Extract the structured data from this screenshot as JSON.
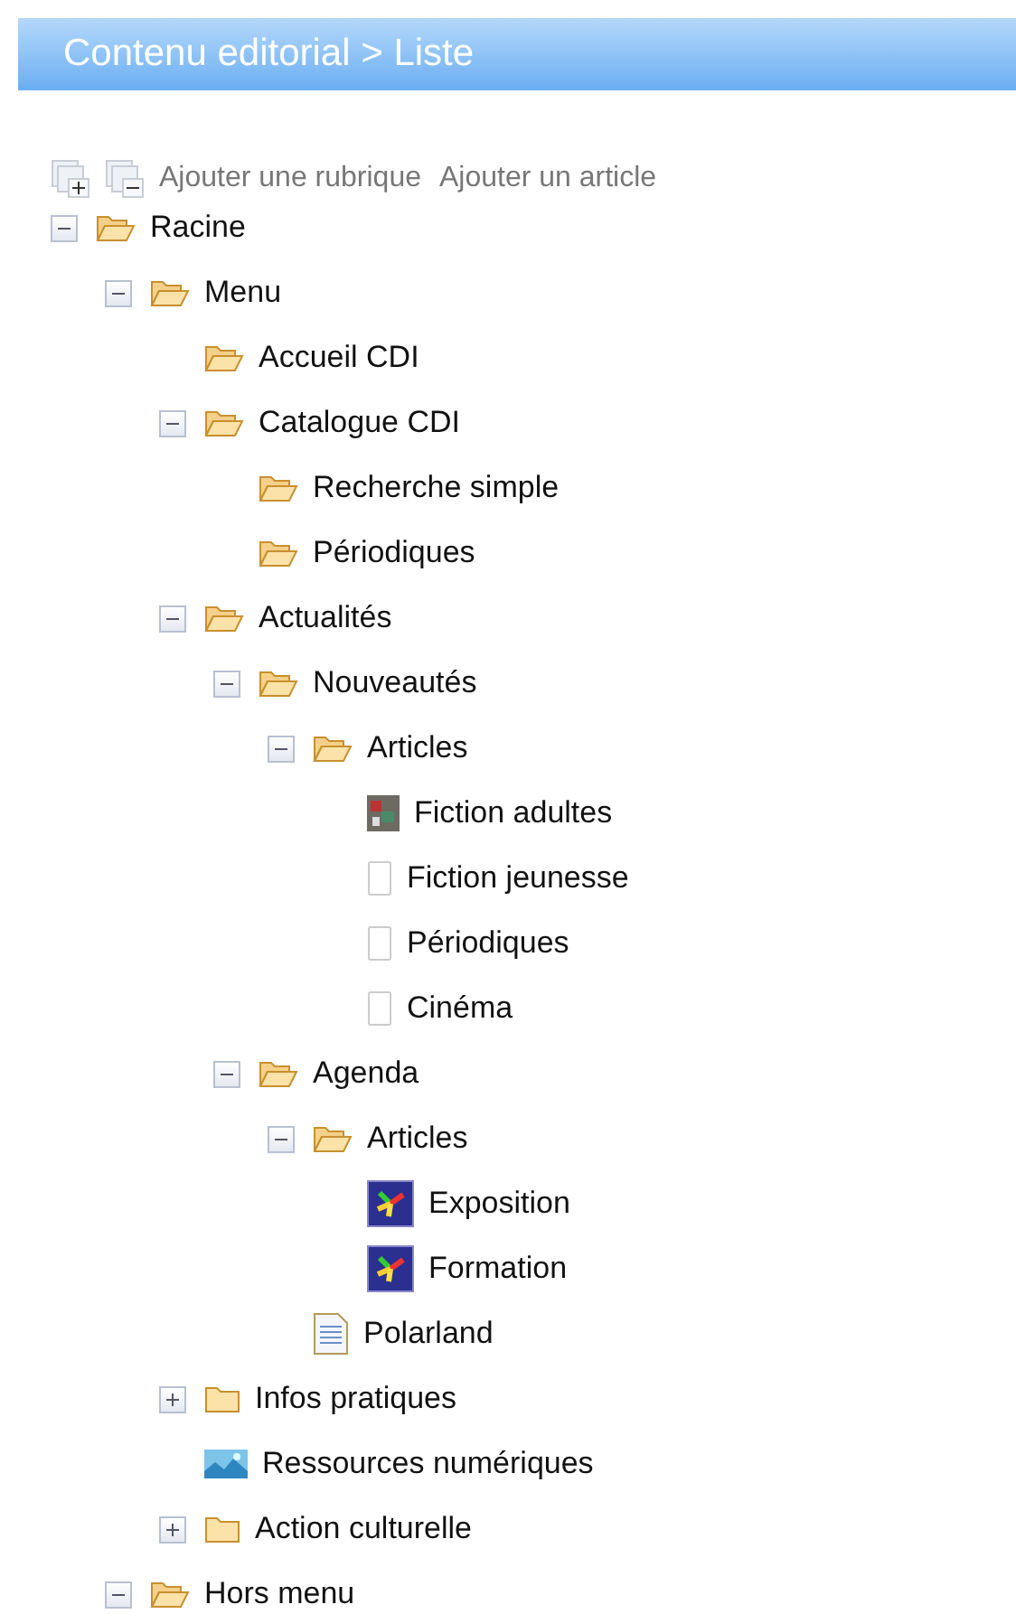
{
  "header": {
    "title": "Contenu editorial > Liste"
  },
  "toolbar": {
    "links": [
      "Ajouter une rubrique",
      "Ajouter un article"
    ]
  },
  "tree": [
    {
      "label": "Racine",
      "kind": "folder_open",
      "expanded": true,
      "children": [
        {
          "label": "Menu",
          "kind": "folder_open",
          "expanded": true,
          "children": [
            {
              "label": "Accueil CDI",
              "kind": "folder_open"
            },
            {
              "label": "Catalogue CDI",
              "kind": "folder_open",
              "expanded": true,
              "children": [
                {
                  "label": "Recherche simple",
                  "kind": "folder_open"
                },
                {
                  "label": "Périodiques",
                  "kind": "folder_open"
                }
              ]
            },
            {
              "label": "Actualités",
              "kind": "folder_open",
              "expanded": true,
              "children": [
                {
                  "label": "Nouveautés",
                  "kind": "folder_open",
                  "expanded": true,
                  "children": [
                    {
                      "label": "Articles",
                      "kind": "folder_open",
                      "expanded": true,
                      "children": [
                        {
                          "label": "Fiction adultes",
                          "kind": "photo"
                        },
                        {
                          "label": "Fiction jeunesse",
                          "kind": "blank"
                        },
                        {
                          "label": "Périodiques",
                          "kind": "blank"
                        },
                        {
                          "label": "Cinéma",
                          "kind": "blank"
                        }
                      ]
                    }
                  ]
                },
                {
                  "label": "Agenda",
                  "kind": "folder_open",
                  "expanded": true,
                  "children": [
                    {
                      "label": "Articles",
                      "kind": "folder_open",
                      "expanded": true,
                      "children": [
                        {
                          "label": "Exposition",
                          "kind": "star"
                        },
                        {
                          "label": "Formation",
                          "kind": "star"
                        }
                      ]
                    },
                    {
                      "label": "Polarland",
                      "kind": "document"
                    }
                  ]
                }
              ]
            },
            {
              "label": "Infos pratiques",
              "kind": "folder",
              "expanded": false
            },
            {
              "label": "Ressources numériques",
              "kind": "image"
            },
            {
              "label": "Action culturelle",
              "kind": "folder",
              "expanded": false
            }
          ]
        },
        {
          "label": "Hors menu",
          "kind": "folder_open",
          "expanded": true
        }
      ]
    }
  ]
}
